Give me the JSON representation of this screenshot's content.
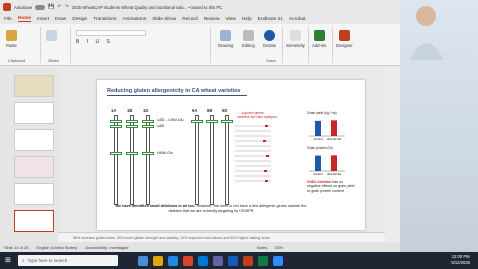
{
  "titlebar": {
    "autosave": "AutoSave",
    "toggle_state": "Off",
    "title": "2025 WheatCAP students Wheat Quality and nutritional valu... • Saved to this PC"
  },
  "menu": [
    "File",
    "Home",
    "Insert",
    "Draw",
    "Design",
    "Transitions",
    "Animations",
    "Slide Show",
    "Record",
    "Review",
    "View",
    "Help",
    "EndNote 21",
    "Acrobat"
  ],
  "menu_active": "Home",
  "ribbon": {
    "paste": "Paste",
    "clipboard": "Clipboard",
    "slides": "Slides",
    "drawing": "Drawing",
    "editing": "Editing",
    "dictate": "Dictate",
    "voice": "Voice",
    "sensitivity": "Sensitivity",
    "addins": "Add-ins",
    "designer": "Designer"
  },
  "thumbnails": [
    "",
    "",
    "",
    "",
    "",
    "",
    ""
  ],
  "slide": {
    "title": "Reducing gluten allergenicity in CA wheat varieties",
    "chromosomes": [
      "1A",
      "1B",
      "1D",
      "6A",
      "6B",
      "6D"
    ],
    "labels": [
      "ω5D – LMW-Glu",
      "ω5D",
      "HMW-Glu"
    ],
    "legend_text": "← α-gluten genes\nvarieties are rabs epitopes",
    "chart1_title": "Grain yield (kg / ha)",
    "chart2_title": "Grain protein (%)",
    "chart_labels": [
      "Control",
      "αG1-D2 del"
    ],
    "deletion_note_bold": "GliD2 deletion",
    "deletion_note": "has no negative effects on grain yield or grain protein content",
    "bottom_text_bold": "We have identified small deletions in all loci.",
    "bottom_text": " However, the ones in red have a few allergenic genes outside the deletion that we are currently targeting by CRISPR"
  },
  "notes": "58% increase gluten index, 50% more gluten strength and stability, 15% improved loaf volume and 50% higher baking score",
  "status": {
    "slide_info": "Slide 13 of 26",
    "language": "English (United States)",
    "accessibility": "Accessibility: Investigate",
    "notes": "Notes",
    "zoom": "53%"
  },
  "taskbar": {
    "search_placeholder": "Type here to search",
    "time": "12:00 PM",
    "date": "5/12/2025"
  },
  "colors": {
    "accent": "#c43e1c",
    "control_bar": "#1e5aa8",
    "deletion_bar": "#c62828",
    "gene_box": "#3a8b3a"
  },
  "chart_data": [
    {
      "type": "bar",
      "title": "Grain yield (kg / ha)",
      "categories": [
        "Control",
        "αG1-D2 del"
      ],
      "values": [
        6.0,
        6.2
      ]
    },
    {
      "type": "bar",
      "title": "Grain protein (%)",
      "categories": [
        "Control",
        "αG1-D2 del"
      ],
      "values": [
        13.5,
        13.7
      ]
    }
  ]
}
